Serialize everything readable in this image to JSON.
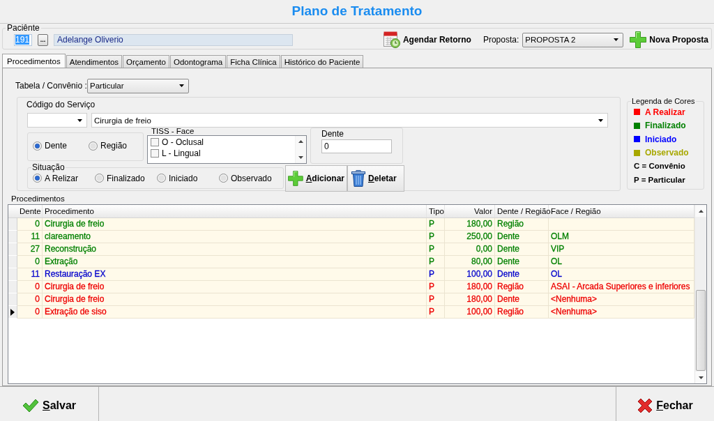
{
  "window": {
    "title": "Plano de Tratamento"
  },
  "patient": {
    "label": "Paciênte",
    "id": {
      "value": "191",
      "text_selected": true
    },
    "browse_button": "...",
    "name": "Adelange Oliverio"
  },
  "toolbar": {
    "schedule_button": "Agendar Retorno",
    "proposal_label": "Proposta:",
    "proposal": "PROPOSTA 2",
    "new_proposal_button": "Nova Proposta"
  },
  "tabs": [
    {
      "label": "Procedimentos",
      "selected": true
    },
    {
      "label": "Atendimentos",
      "selected": false
    },
    {
      "label": "Orçamento",
      "selected": false
    },
    {
      "label": "Odontograma",
      "selected": false
    },
    {
      "label": "Ficha Clínica",
      "selected": false
    },
    {
      "label": "Histórico do Paciente",
      "selected": false
    }
  ],
  "form": {
    "table_label": "Tabela / Convênio :",
    "table_value": "Particular",
    "service_code_label": "Código do Serviço",
    "service_name": "Cirurgia de freio",
    "target_options": [
      {
        "label": "Dente",
        "selected": true
      },
      {
        "label": "Região",
        "selected": false
      }
    ],
    "tiss_face": {
      "label": "TISS - Face",
      "items": [
        {
          "label": "O - Oclusal",
          "checked": false
        },
        {
          "label": "L - Lingual",
          "checked": false
        }
      ]
    },
    "tooth": {
      "label": "Dente",
      "value": "0"
    },
    "status": {
      "label": "Situação",
      "options": [
        {
          "label": "A Relizar",
          "selected": true
        },
        {
          "label": "Finalizado",
          "selected": false
        },
        {
          "label": "Iniciado",
          "selected": false
        },
        {
          "label": "Observado",
          "selected": false
        }
      ]
    },
    "add_button": "Adicionar",
    "delete_button": "Deletar"
  },
  "legend": {
    "title": "Legenda de Cores",
    "items": [
      {
        "label": "A Realizar",
        "color": "#ff0000"
      },
      {
        "label": "Finalizado",
        "color": "#008000"
      },
      {
        "label": "Iniciado",
        "color": "#0000ff"
      },
      {
        "label": "Observado",
        "color": "#a8a800"
      }
    ],
    "notes": [
      "C = Convênio",
      "P = Particular"
    ]
  },
  "procedures": {
    "label": "Procedimentos",
    "columns": [
      "Dente",
      "Procedimento",
      "Tipo",
      "Valor",
      "Dente / Região",
      "Face / Região"
    ],
    "rows": [
      {
        "tooth": "0",
        "procedure": "Cirurgia de freio",
        "type": "P",
        "value": "180,00",
        "target": "Região",
        "color": "#008000",
        "selected": false
      },
      {
        "tooth": "11",
        "procedure": "clareamento",
        "type": "P",
        "value": "250,00",
        "target": "Dente",
        "face": "OLM",
        "color": "#008000",
        "selected": false
      },
      {
        "tooth": "27",
        "procedure": "Reconstrução",
        "type": "P",
        "value": "0,00",
        "target": "Dente",
        "face": "VIP",
        "color": "#008000",
        "selected": false
      },
      {
        "tooth": "0",
        "procedure": "Extração",
        "type": "P",
        "value": "80,00",
        "target": "Dente",
        "face": "OL",
        "color": "#008000",
        "selected": false
      },
      {
        "tooth": "11",
        "procedure": "Restauração EX",
        "type": "P",
        "value": "100,00",
        "target": "Dente",
        "face": "OL",
        "color": "#0000cc",
        "selected": false
      },
      {
        "tooth": "0",
        "procedure": "Cirurgia de freio",
        "type": "P",
        "value": "180,00",
        "target": "Região",
        "face": "ASAI - Arcada Superiores e inferiores",
        "color": "#ee0000",
        "selected": false
      },
      {
        "tooth": "0",
        "procedure": "Cirurgia de freio",
        "type": "P",
        "value": "180,00",
        "target": "Dente",
        "face": "<Nenhuma>",
        "color": "#ee0000",
        "selected": false
      },
      {
        "tooth": "0",
        "procedure": "Extração de siso",
        "type": "P",
        "value": "100,00",
        "target": "Região",
        "face": "<Nenhuma>",
        "color": "#ee0000",
        "selected": true
      }
    ]
  },
  "footer": {
    "save_button": "Salvar",
    "close_button": "Fechar"
  }
}
